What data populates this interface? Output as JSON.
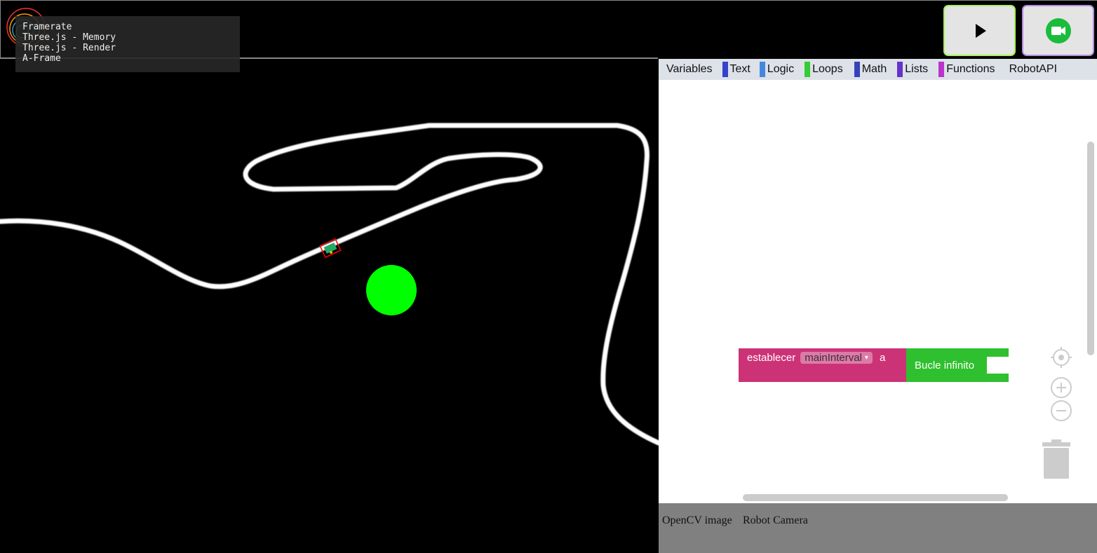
{
  "stats": {
    "lines": [
      "Framerate",
      "Three.js - Memory",
      "Three.js - Render",
      "A-Frame"
    ]
  },
  "controls": {
    "play_icon": "play-icon",
    "record_icon": "video-camera-icon",
    "record_color": "#1abc3c"
  },
  "scene": {
    "background": "#000000",
    "track_color": "#ffffff",
    "ball_color": "#00ff00",
    "robot_outline_color": "#ff0000"
  },
  "toolbox": {
    "categories": [
      {
        "label": "Variables",
        "color": ""
      },
      {
        "label": "Text",
        "color": "#3344cc"
      },
      {
        "label": "Logic",
        "color": "#4488dd"
      },
      {
        "label": "Loops",
        "color": "#33cc33"
      },
      {
        "label": "Math",
        "color": "#3344bb"
      },
      {
        "label": "Lists",
        "color": "#6633cc"
      },
      {
        "label": "Functions",
        "color": "#bb33cc"
      },
      {
        "label": "RobotAPI",
        "color": ""
      }
    ]
  },
  "workspace": {
    "set_block": {
      "prefix": "establecer",
      "variable": "mainInterval",
      "dropdown_arrow": "▾",
      "suffix": "a",
      "color": "#cc3377"
    },
    "loop_block": {
      "label": "Bucle infinito",
      "color": "#2fc02f"
    }
  },
  "bottom_tabs": [
    "OpenCV image",
    "Robot Camera"
  ]
}
